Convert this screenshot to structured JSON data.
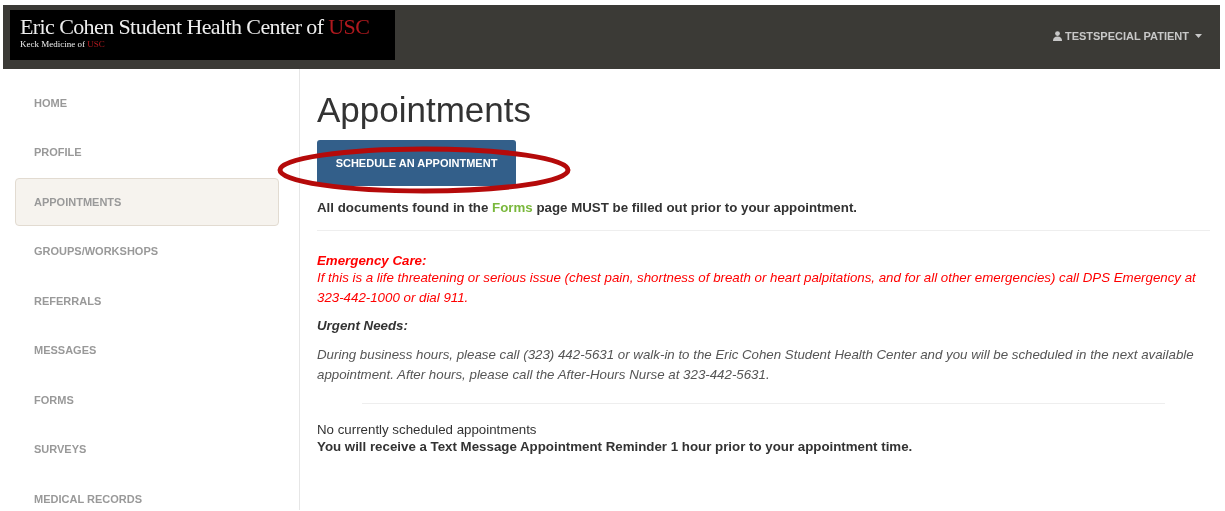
{
  "header": {
    "logo_title": "Eric Cohen Student Health Center of",
    "logo_title_accent": "USC",
    "logo_subtitle": "Keck Medicine of",
    "logo_subtitle_accent": "USC",
    "user_menu": "TESTSPECIAL PATIENT"
  },
  "sidebar": {
    "items": [
      {
        "label": "HOME",
        "selected": false
      },
      {
        "label": "PROFILE",
        "selected": false
      },
      {
        "label": "APPOINTMENTS",
        "selected": true
      },
      {
        "label": "GROUPS/WORKSHOPS",
        "selected": false
      },
      {
        "label": "REFERRALS",
        "selected": false
      },
      {
        "label": "MESSAGES",
        "selected": false
      },
      {
        "label": "FORMS",
        "selected": false
      },
      {
        "label": "SURVEYS",
        "selected": false
      },
      {
        "label": "MEDICAL RECORDS",
        "selected": false
      }
    ]
  },
  "main": {
    "title": "Appointments",
    "schedule_button": "SCHEDULE AN APPOINTMENT",
    "highlighted": true,
    "notice": {
      "before": "All documents found in the",
      "link": "Forms",
      "after": "page MUST be filled out prior to your appointment."
    },
    "emergency": {
      "heading": "Emergency Care:",
      "text": "If this is a life threatening or serious issue (chest pain, shortness of breath or heart palpitations, and for all other emergencies) call DPS Emergency at 323-442-1000 or dial 911."
    },
    "urgent": {
      "heading": "Urgent Needs:",
      "text": "During business hours, please call (323) 442-5631 or walk-in to the Eric Cohen Student Health Center and you will be scheduled in the next available appointment. After hours, please call the After-Hours Nurse at 323-442-5631."
    },
    "empty_message": "No currently scheduled appointments",
    "reminder": "You will receive a Text Message Appointment Reminder 1 hour prior to your appointment time."
  }
}
